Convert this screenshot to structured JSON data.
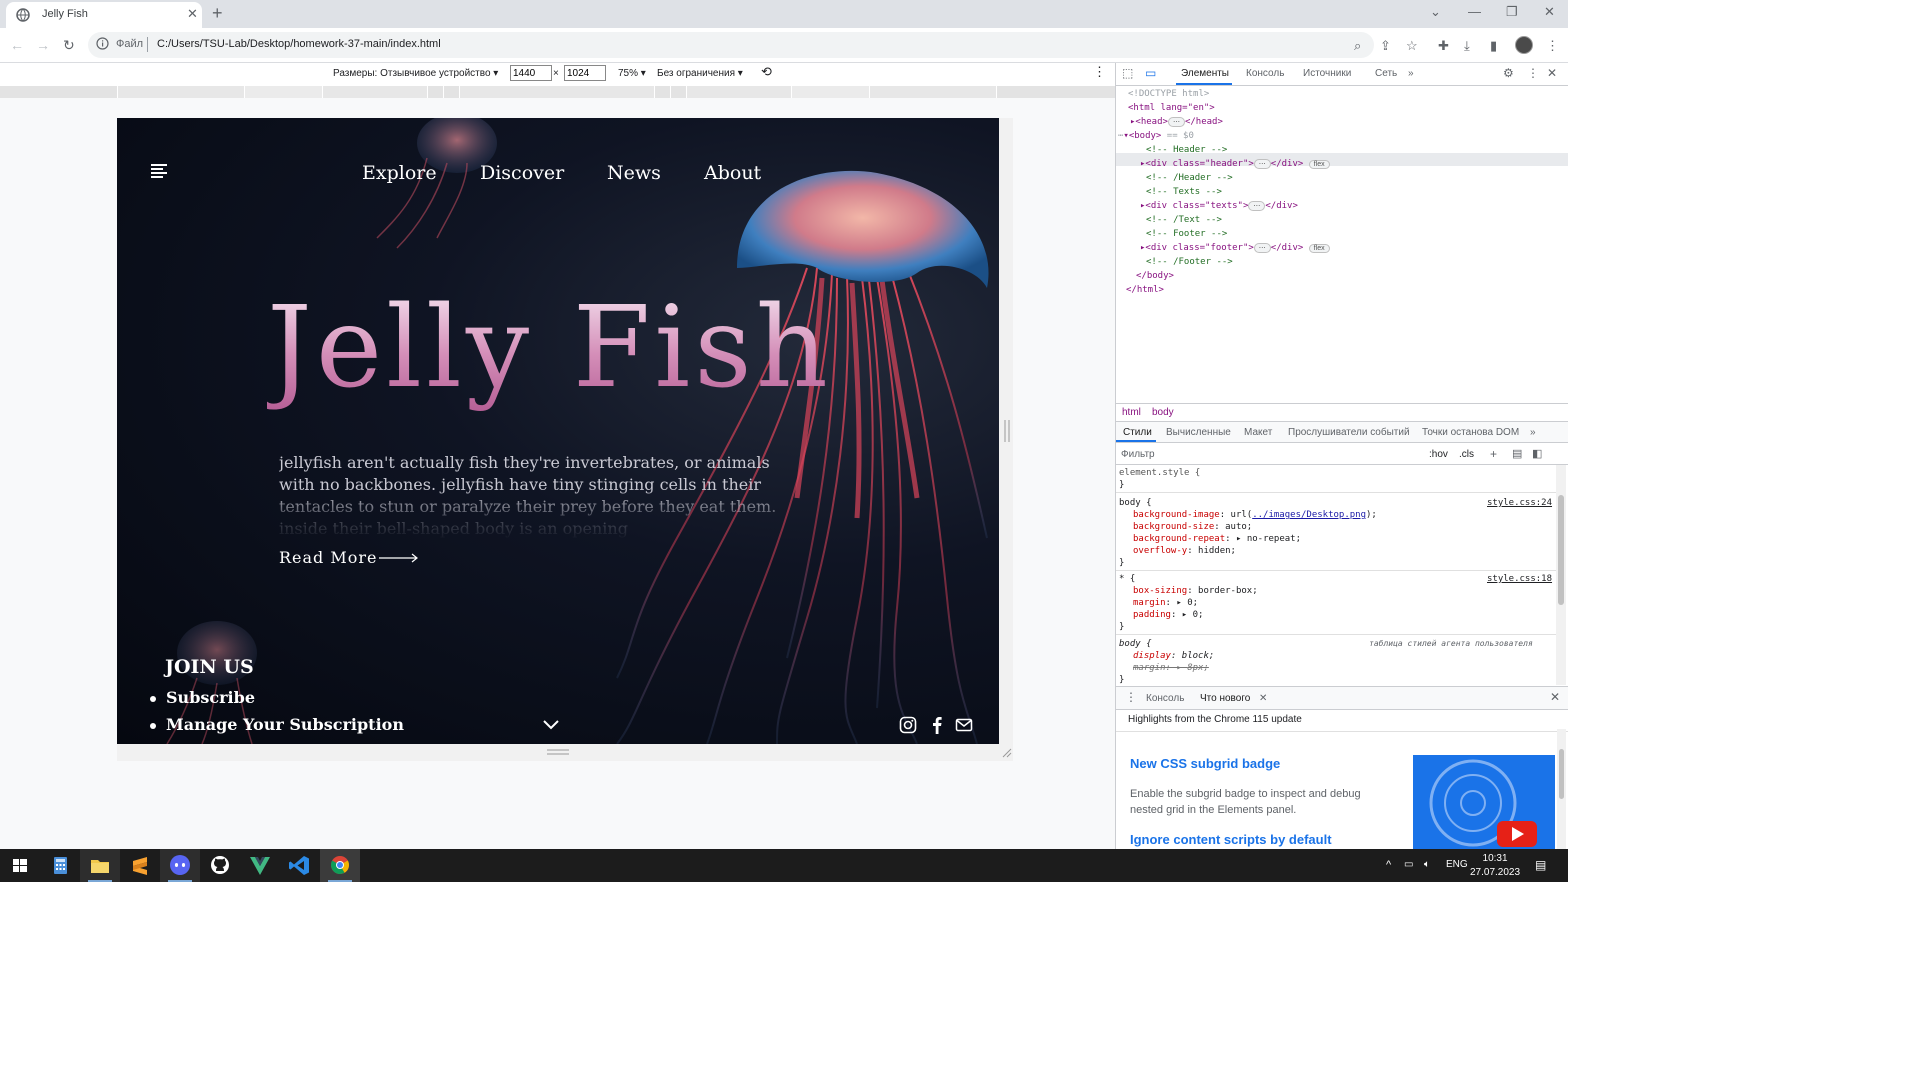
{
  "browser": {
    "tab_title": "Jelly Fish",
    "tab_close": "✕",
    "new_tab": "+",
    "window_controls": [
      "⌄",
      "—",
      "❐",
      "✕"
    ],
    "protocol_label": "Файл",
    "url": "C:/Users/TSU-Lab/Desktop/homework-37-main/index.html"
  },
  "device_toolbar": {
    "dimensions_label": "Размеры: Отзывчивое устройство",
    "width": "1440",
    "times": "×",
    "height": "1024",
    "zoom": "75%",
    "throttle": "Без ограничения"
  },
  "site": {
    "nav": [
      "Explore",
      "Discover",
      "News",
      "About"
    ],
    "title": "Jelly Fish",
    "description": "jellyfish aren't actually fish they're invertebrates, or animals with no backbones. jellyfish have tiny stinging cells in their tentacles to stun or paralyze their prey before they eat them. inside their bell-shaped body is an opening",
    "read_more": "Read More",
    "join_title": "JOIN US",
    "join_items": [
      "Subscribe",
      "Manage Your Subscription"
    ],
    "social_icons": [
      "instagram-icon",
      "facebook-icon",
      "mail-icon"
    ]
  },
  "devtools": {
    "tabs": [
      "Элементы",
      "Консоль",
      "Источники",
      "Сеть"
    ],
    "more_tabs": "»",
    "dom": {
      "doctype": "<!DOCTYPE html>",
      "html_open": "<html lang=\"en\">",
      "head": "<head>",
      "head_close": "</head>",
      "body_open": "<body>",
      "body_sel": "== $0",
      "c_header": "<!-- Header -->",
      "div_header": "<div class=\"header\">",
      "c_header_end": "<!-- /Header -->",
      "c_texts": "<!-- Texts -->",
      "div_texts": "<div class=\"texts\">",
      "c_text_end": "<!-- /Text -->",
      "c_footer": "<!-- Footer -->",
      "div_footer": "<div class=\"footer\">",
      "c_footer_end": "<!-- /Footer -->",
      "div_close": "</div>",
      "body_close": "</body>",
      "html_close": "</html>",
      "badge": "flex",
      "ellipsis": "⋯"
    },
    "breadcrumbs": [
      "html",
      "body"
    ],
    "style_tabs": [
      "Стили",
      "Вычисленные",
      "Макет",
      "Прослушиватели событий",
      "Точки останова DOM"
    ],
    "filter_placeholder": "Фильтр",
    "filter_hov": ":hov",
    "filter_cls": ".cls",
    "styles": {
      "element_style": "element.style {",
      "close": "}",
      "body_sel": "body {",
      "body_src": "style.css:24",
      "bg_image_prop": "background-image",
      "bg_image_val": "../images/Desktop.png",
      "bg_size_prop": "background-size",
      "bg_size_val": "auto;",
      "bg_repeat_prop": "background-repeat",
      "bg_repeat_val": "no-repeat;",
      "overflow_prop": "overflow-y",
      "overflow_val": "hidden;",
      "star_sel": "* {",
      "star_src": "style.css:18",
      "box_prop": "box-sizing",
      "box_val": "border-box;",
      "margin_prop": "margin",
      "margin_val": "0;",
      "padding_prop": "padding",
      "padding_val": "0;",
      "ua_sel": "body {",
      "ua_src": "таблица стилей агента пользователя",
      "display_prop": "display",
      "display_val": "block;",
      "ua_margin_prop": "margin",
      "ua_margin_val": "8px;"
    },
    "drawer_tabs": [
      "Консоль",
      "Что нового"
    ],
    "whats_new": {
      "highlights": "Highlights from the Chrome 115 update",
      "h1": "New CSS subgrid badge",
      "p": "Enable the subgrid badge to inspect and debug nested grid in the Elements panel.",
      "h2": "Ignore content scripts by default"
    }
  },
  "taskbar": {
    "apps": [
      "windows-start",
      "calculator",
      "file-explorer",
      "sublime-text",
      "discord",
      "github",
      "vue",
      "vscode",
      "chrome"
    ],
    "lang": "ENG",
    "time": "10:31",
    "date": "27.07.2023"
  },
  "colors": {
    "accent": "#1a73e8",
    "page_bg": "#050810",
    "title_pink": "#d48eb8"
  }
}
